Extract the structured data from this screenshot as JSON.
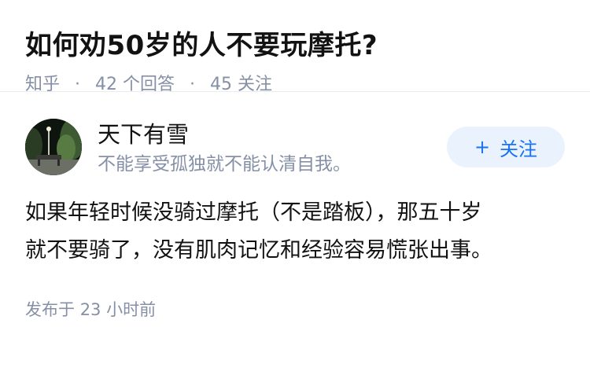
{
  "question": {
    "title": "如何劝50岁的人不要玩摩托?",
    "source": "知乎",
    "separator": "·",
    "answers_count": "42",
    "answers_label": "个回答",
    "followers_count": "45",
    "followers_label": "关注"
  },
  "answer": {
    "author": {
      "name": "天下有雪",
      "bio": "不能享受孤独就不能认清自我。"
    },
    "follow_button": {
      "plus": "+",
      "label": "关注"
    },
    "content_lines": [
      "如果年轻时候没骑过摩托（不是踏板），那五十岁",
      "就不要骑了，没有肌肉记忆和经验容易慌张出事。"
    ],
    "posted_label": "发布于",
    "posted_time": "23 小时前"
  },
  "colors": {
    "meta_gray": "#8590a6",
    "accent_blue": "#1772f6",
    "follow_bg": "#eaf2fd"
  }
}
